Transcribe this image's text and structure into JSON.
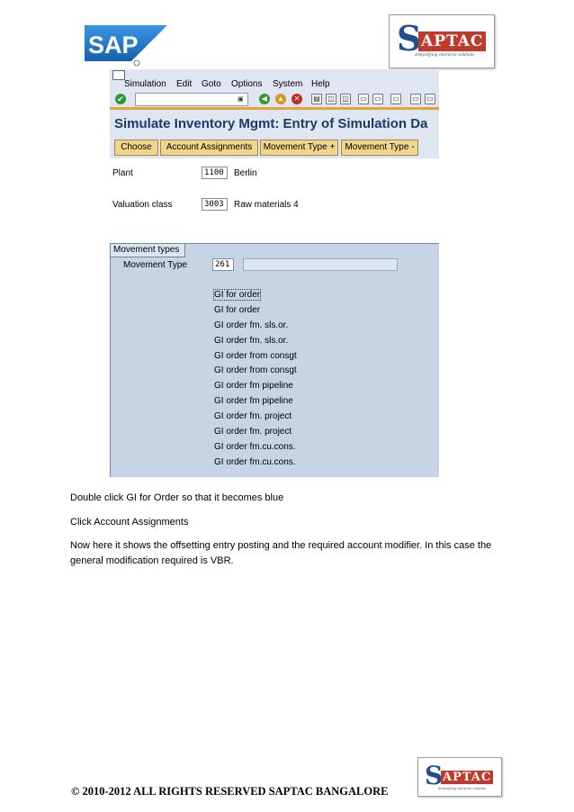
{
  "logos": {
    "sap": "SAP",
    "saptac_letter": "S",
    "saptac_rest": "APTAC",
    "saptac_tagline": "demystifying enterprise solutions"
  },
  "menu": [
    "Simulation",
    "Edit",
    "Goto",
    "Options",
    "System",
    "Help"
  ],
  "title": "Simulate Inventory Mgmt: Entry of Simulation Da",
  "app_buttons": [
    "Choose",
    "Account Assignments",
    "Movement Type +",
    "Movement Type -"
  ],
  "plant": {
    "label": "Plant",
    "value": "1100",
    "text": "Berlin"
  },
  "valuation_class": {
    "label": "Valuation class",
    "value": "3003",
    "text": "Raw materials 4"
  },
  "movement_types": {
    "group_title": "Movement types",
    "field_label": "Movement Type",
    "field_value": "261",
    "list": [
      "GI for order",
      "GI for order",
      "GI order fm. sls.or.",
      "GI order fm. sls.or.",
      "GI order from consgt",
      "GI order from consgt",
      "GI order fm pipeline",
      "GI order fm pipeline",
      "GI order fm. project",
      "GI order fm. project",
      "GI order fm.cu.cons.",
      "GI order fm.cu.cons."
    ]
  },
  "instructions": [
    "Double click GI for Order so that it becomes blue",
    "Click Account Assignments",
    "Now here it shows the offsetting entry posting and the required account modifier. In this case the general modification required is VBR."
  ],
  "footer": "© 2010-2012 ALL RIGHTS RESERVED SAPTAC BANGALORE",
  "colors": {
    "sap_blue": "#1e6fc0",
    "saptac_red": "#c0392b",
    "panel": "#c6d4e6",
    "button": "#f2d58a",
    "title": "#1a3a6a"
  }
}
